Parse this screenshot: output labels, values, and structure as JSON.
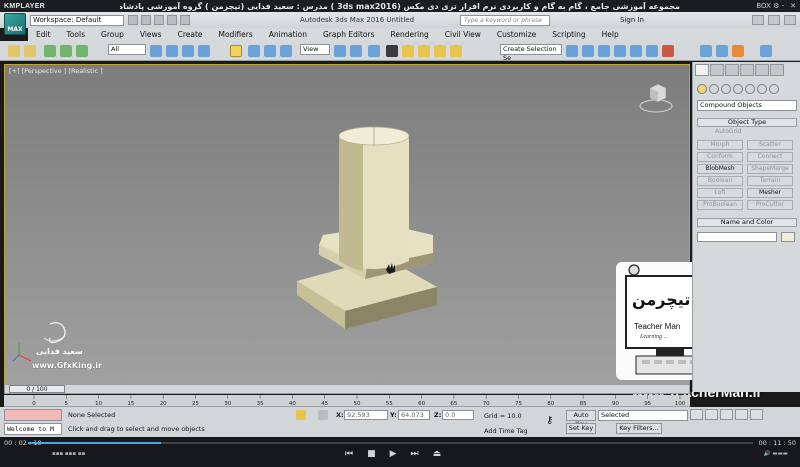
{
  "player": {
    "logo": "KMPLAYER",
    "title": "مجموعه آموزشی جامع ، گام به گام و کاربردی نرم افزار تری دی مکس (3ds max2016 ) مدرس : سعید فدایی (تیچرمن ) گروه آموزشی پادشاه گرافیست ها",
    "right_label": "BOX ⚙ -",
    "time_current": "00 : 02 : 10",
    "time_total": "00 : 11 : 50",
    "progress": 0.184
  },
  "max": {
    "logo_label": "MAX",
    "workspace": "Workspace: Default",
    "app_title": "Autodesk 3ds Max 2016     Untitled",
    "search_placeholder": "Type a keyword or phrase",
    "signin": "Sign In",
    "menu": [
      "Edit",
      "Tools",
      "Group",
      "Views",
      "Create",
      "Modifiers",
      "Animation",
      "Graph Editors",
      "Rendering",
      "Civil View",
      "Customize",
      "Scripting",
      "Help"
    ],
    "filter_dropdown": "All",
    "view_dropdown": "View",
    "selection_set": "Create Selection Se"
  },
  "viewport": {
    "label": "[+] [Perspective ] [Realistic ]"
  },
  "command_panel": {
    "category_dropdown": "Compound Objects",
    "object_type_title": "Object Type",
    "autogrid": "AutoGrid",
    "buttons": [
      {
        "label": "Morph",
        "active": false
      },
      {
        "label": "Scatter",
        "active": false
      },
      {
        "label": "Conform",
        "active": false
      },
      {
        "label": "Connect",
        "active": false
      },
      {
        "label": "BlobMesh",
        "active": true
      },
      {
        "label": "ShapeMerge",
        "active": false
      },
      {
        "label": "Boolean",
        "active": false
      },
      {
        "label": "Terrain",
        "active": false
      },
      {
        "label": "Loft",
        "active": false
      },
      {
        "label": "Mesher",
        "active": true
      },
      {
        "label": "ProBoolean",
        "active": false
      },
      {
        "label": "ProCutter",
        "active": false
      }
    ],
    "name_color_title": "Name and Color"
  },
  "timeline": {
    "slider_label": "0 / 100",
    "ticks": [
      "0",
      "5",
      "10",
      "15",
      "20",
      "25",
      "30",
      "35",
      "40",
      "45",
      "50",
      "55",
      "60",
      "65",
      "70",
      "75",
      "80",
      "85",
      "90",
      "95",
      "100"
    ]
  },
  "status": {
    "listener": "Welcome to M",
    "selected": "None Selected",
    "prompt": "Click and drag to select and move objects",
    "x_label": "X:",
    "x_value": "92.593",
    "y_label": "Y:",
    "y_value": "64.073",
    "z_label": "Z:",
    "z_value": "0.0",
    "grid": "Grid = 10.0",
    "add_time_tag": "Add Time Tag",
    "auto_key": "Auto Key",
    "set_key": "Set Key",
    "selected_dropdown": "Selected",
    "key_filters": "Key Filters..."
  },
  "watermark": {
    "author_name": "سعید فدایی",
    "gfx_url": "www.GfxKing.ir",
    "teacher_url": "www.TeacherMan.ir",
    "brand_fa": "تیچرمن",
    "brand_en": "Teacher Man",
    "tagline": "Learning ..."
  }
}
